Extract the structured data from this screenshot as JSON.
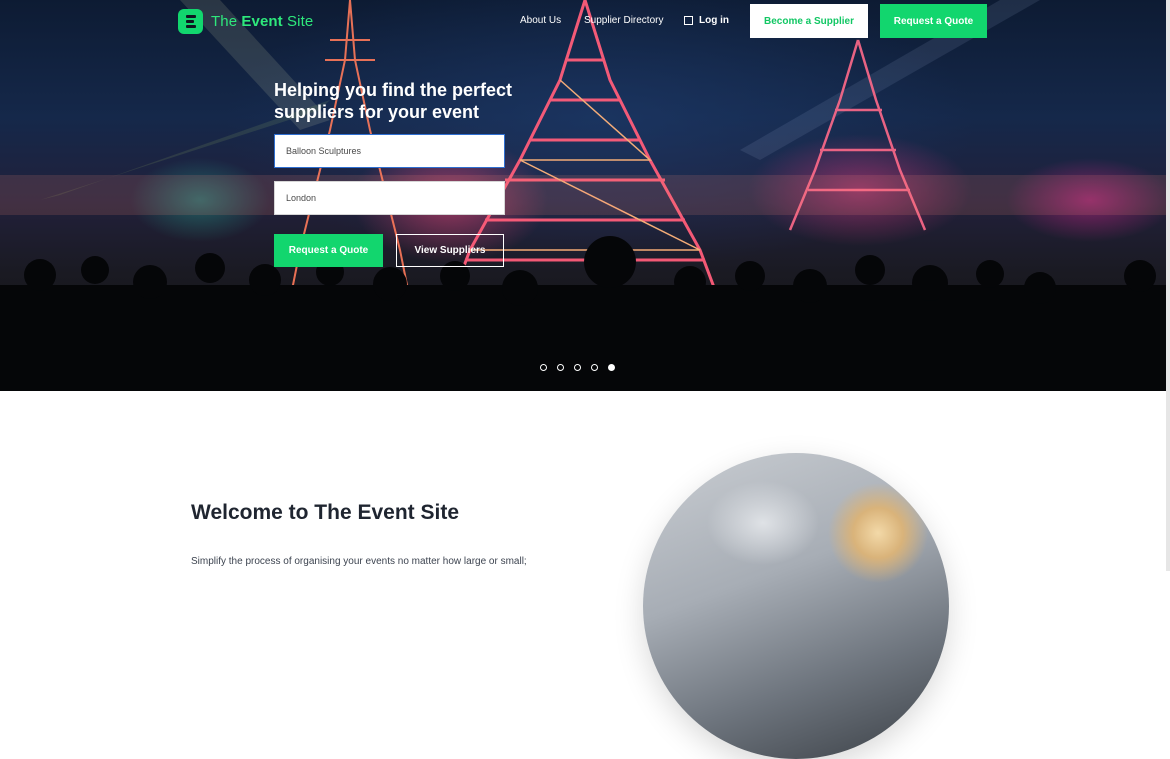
{
  "header": {
    "logo_prefix": "The ",
    "logo_emphasis": "Event",
    "logo_suffix": " Site",
    "nav": {
      "about": "About Us",
      "directory": "Supplier Directory",
      "login": "Log in"
    },
    "become_supplier": "Become a Supplier",
    "request_quote": "Request a Quote"
  },
  "hero": {
    "headline": "Helping you find the perfect suppliers for your event",
    "search": {
      "value": "Balloon Sculptures"
    },
    "location": {
      "value": "London"
    },
    "request_quote": "Request a Quote",
    "view_suppliers": "View Suppliers",
    "slides": {
      "count": 5,
      "active_index": 5
    }
  },
  "welcome": {
    "title": "Welcome to The Event Site",
    "text": "Simplify the process of organising your events no matter how large or small;"
  },
  "colors": {
    "brand_green": "#12d66e",
    "dark_text": "#1f2530"
  },
  "icons": {
    "logo": "event-site-logo-icon",
    "login": "login-icon"
  }
}
